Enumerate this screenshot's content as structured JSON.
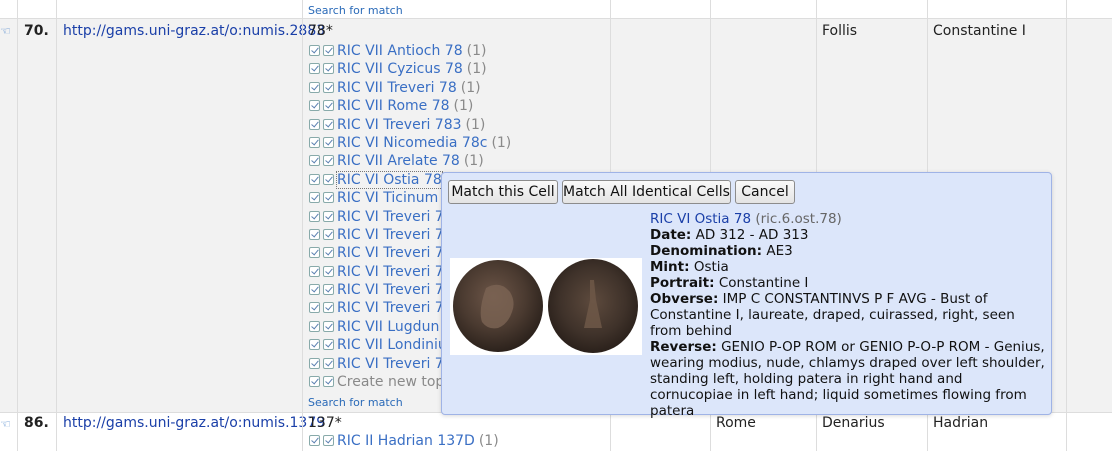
{
  "search_for_match": "Search for match",
  "rows": [
    {
      "num": "70.",
      "uri": "http://gams.uni-graz.at/o:numis.2883",
      "value": "78*",
      "mint": "",
      "denomination": "Follis",
      "authority": "Constantine I",
      "matches": [
        {
          "label": "RIC VII Antioch 78",
          "count": "(1)"
        },
        {
          "label": "RIC VII Cyzicus 78",
          "count": "(1)"
        },
        {
          "label": "RIC VII Treveri 78",
          "count": "(1)"
        },
        {
          "label": "RIC VII Rome 78",
          "count": "(1)"
        },
        {
          "label": "RIC VI Treveri 783",
          "count": "(1)"
        },
        {
          "label": "RIC VI Nicomedia 78c",
          "count": "(1)"
        },
        {
          "label": "RIC VII Arelate 78",
          "count": "(1)"
        },
        {
          "label": "RIC VI Ostia 78",
          "count": ""
        },
        {
          "label": "RIC VI Ticinum",
          "count": ""
        },
        {
          "label": "RIC VI Treveri 7",
          "count": ""
        },
        {
          "label": "RIC VI Treveri 7",
          "count": ""
        },
        {
          "label": "RIC VI Treveri 7",
          "count": ""
        },
        {
          "label": "RIC VI Treveri 7",
          "count": ""
        },
        {
          "label": "RIC VI Treveri 7",
          "count": ""
        },
        {
          "label": "RIC VI Treveri 7",
          "count": ""
        },
        {
          "label": "RIC VII Lugdun",
          "count": ""
        },
        {
          "label": "RIC VII Londiniu",
          "count": ""
        },
        {
          "label": "RIC VI Treveri 7",
          "count": ""
        }
      ],
      "create_label": "Create new top"
    },
    {
      "num": "86.",
      "uri": "http://gams.uni-graz.at/o:numis.1379",
      "value": "137*",
      "mint": "Rome",
      "denomination": "Denarius",
      "authority": "Hadrian",
      "matches": [
        {
          "label": "RIC II Hadrian 137D",
          "count": "(1)"
        }
      ]
    }
  ],
  "popup": {
    "match_cell": "Match this Cell",
    "match_all": "Match All Identical Cells",
    "cancel": "Cancel",
    "coin_title": "RIC VI Ostia 78",
    "coin_id": "(ric.6.ost.78)",
    "fields": [
      {
        "label": "Date:",
        "value": "AD 312 - AD 313"
      },
      {
        "label": "Denomination:",
        "value": "AE3"
      },
      {
        "label": "Mint:",
        "value": "Ostia"
      },
      {
        "label": "Portrait:",
        "value": "Constantine I"
      },
      {
        "label": "Obverse:",
        "value": "IMP C CONSTANTINVS P F AVG - Bust of Constantine I, laureate, draped, cuirassed, right, seen from behind"
      },
      {
        "label": "Reverse:",
        "value": "GENIO P-OP ROM or GENIO P-O-P ROM - Genius, wearing modius, nude, chlamys draped over left shoulder, standing left, holding patera in right hand and cornucopiae in left hand; liquid sometimes flowing from patera"
      }
    ]
  },
  "colors": {
    "link": "#1a3fa8",
    "match_link": "#3a6fc4",
    "popup_bg": "#dce6fa",
    "row_highlight": "#f2f2f2"
  },
  "icons": {
    "row_handle": "hand-pointer-icon",
    "checkbox": "checkbox-checked-icon"
  }
}
